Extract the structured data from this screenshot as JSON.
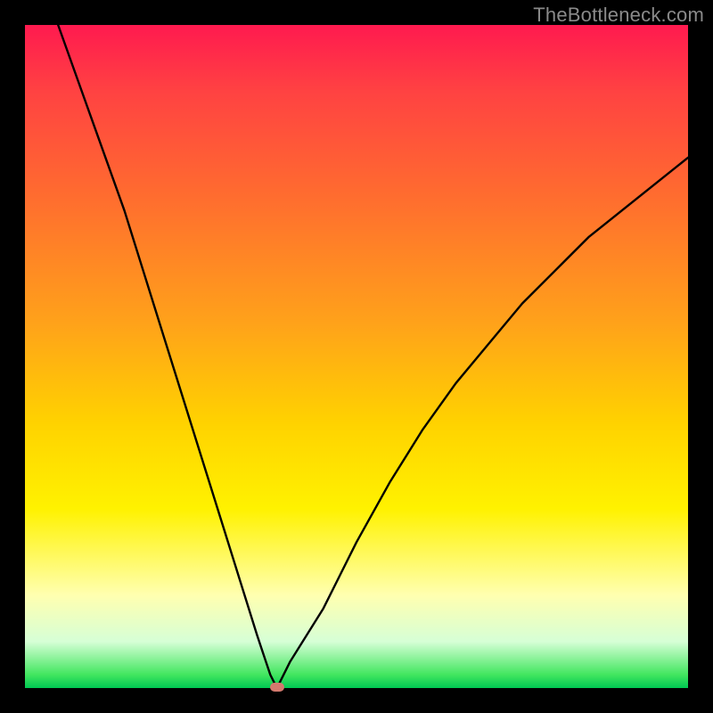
{
  "watermark": "TheBottleneck.com",
  "chart_data": {
    "type": "line",
    "title": "",
    "xlabel": "",
    "ylabel": "",
    "xlim": [
      0,
      100
    ],
    "ylim": [
      0,
      100
    ],
    "notch_x": 38,
    "marker": {
      "x": 38,
      "y": 0,
      "color": "#d4796e"
    },
    "gradient_stops": [
      {
        "pos": 0,
        "color": "#ff1a4f"
      },
      {
        "pos": 25,
        "color": "#ff6a30"
      },
      {
        "pos": 60,
        "color": "#ffd200"
      },
      {
        "pos": 86,
        "color": "#ffffb0"
      },
      {
        "pos": 100,
        "color": "#00c853"
      }
    ],
    "series": [
      {
        "name": "curve-left",
        "x": [
          5,
          7.5,
          10,
          12.5,
          15,
          17.5,
          20,
          22.5,
          25,
          27.5,
          30,
          32.5,
          35,
          36,
          37,
          38
        ],
        "values": [
          100,
          93,
          86,
          79,
          72,
          64,
          56,
          48,
          40,
          32,
          24,
          16,
          8,
          5,
          2,
          0
        ]
      },
      {
        "name": "curve-right",
        "x": [
          38,
          39,
          40,
          42.5,
          45,
          47.5,
          50,
          55,
          60,
          65,
          70,
          75,
          80,
          85,
          90,
          95,
          100
        ],
        "values": [
          0,
          2,
          4,
          8,
          12,
          17,
          22,
          31,
          39,
          46,
          52,
          58,
          63,
          68,
          72,
          76,
          80
        ]
      }
    ]
  }
}
